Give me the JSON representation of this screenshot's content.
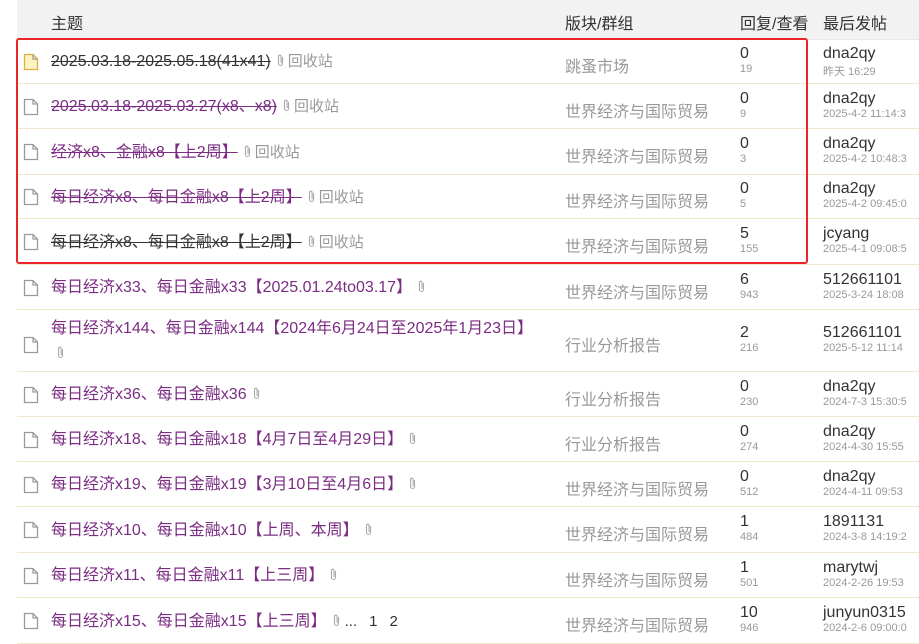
{
  "header": {
    "topic": "主题",
    "forum": "版块/群组",
    "stats": "回复/查看",
    "last_post": "最后发帖"
  },
  "colors": {
    "link_purple": "#7b2c83",
    "highlight_red": "#e8262a",
    "header_bg": "#f2f2f2",
    "row_divider": "#f0e6c8",
    "muted_gray": "#999999"
  },
  "threads": [
    {
      "title": "2025.03.18-2025.05.18(41x41)",
      "recycle": "回收站",
      "forum": "跳蚤市场",
      "replies": "0",
      "views": "19",
      "poster": "dna2qy",
      "time": "昨天 16:29"
    },
    {
      "title": "2025.03.18-2025.03.27(x8、x8)",
      "recycle": "回收站",
      "forum": "世界经济与国际贸易",
      "replies": "0",
      "views": "9",
      "poster": "dna2qy",
      "time": "2025-4-2 11:14:3"
    },
    {
      "title": "经济x8、金融x8【上2周】",
      "recycle": "回收站",
      "forum": "世界经济与国际贸易",
      "replies": "0",
      "views": "3",
      "poster": "dna2qy",
      "time": "2025-4-2 10:48:3"
    },
    {
      "title": "每日经济x8、每日金融x8【上2周】",
      "recycle": "回收站",
      "forum": "世界经济与国际贸易",
      "replies": "0",
      "views": "5",
      "poster": "dna2qy",
      "time": "2025-4-2 09:45:0"
    },
    {
      "title": "每日经济x8、每日金融x8【上2周】",
      "recycle": "回收站",
      "forum": "世界经济与国际贸易",
      "replies": "5",
      "views": "155",
      "poster": "jcyang",
      "time": "2025-4-1 09:08:5"
    },
    {
      "title": "每日经济x33、每日金融x33【2025.01.24to03.17】",
      "recycle": "",
      "forum": "世界经济与国际贸易",
      "replies": "6",
      "views": "943",
      "poster": "512661101",
      "time": "2025-3-24 18:08"
    },
    {
      "title": "每日经济x144、每日金融x144【2024年6月24日至2025年1月23日】",
      "recycle": "",
      "forum": "行业分析报告",
      "replies": "2",
      "views": "216",
      "poster": "512661101",
      "time": "2025-5-12 11:14"
    },
    {
      "title": "每日经济x36、每日金融x36",
      "recycle": "",
      "forum": "行业分析报告",
      "replies": "0",
      "views": "230",
      "poster": "dna2qy",
      "time": "2024-7-3 15:30:5"
    },
    {
      "title": "每日经济x18、每日金融x18【4月7日至4月29日】",
      "recycle": "",
      "forum": "行业分析报告",
      "replies": "0",
      "views": "274",
      "poster": "dna2qy",
      "time": "2024-4-30 15:55"
    },
    {
      "title": "每日经济x19、每日金融x19【3月10日至4月6日】",
      "recycle": "",
      "forum": "世界经济与国际贸易",
      "replies": "0",
      "views": "512",
      "poster": "dna2qy",
      "time": "2024-4-11 09:53"
    },
    {
      "title": "每日经济x10、每日金融x10【上周、本周】",
      "recycle": "",
      "forum": "世界经济与国际贸易",
      "replies": "1",
      "views": "484",
      "poster": "1891131",
      "time": "2024-3-8 14:19:2"
    },
    {
      "title": "每日经济x11、每日金融x11【上三周】",
      "recycle": "",
      "forum": "世界经济与国际贸易",
      "replies": "1",
      "views": "501",
      "poster": "marytwj",
      "time": "2024-2-26 19:53"
    },
    {
      "title": "每日经济x15、每日金融x15【上三周】",
      "recycle": "",
      "forum": "世界经济与国际贸易",
      "replies": "10",
      "views": "946",
      "poster": "junyun0315",
      "time": "2024-2-6 09:00:0",
      "pager": {
        "ellipsis": "...",
        "pages": [
          "1",
          "2"
        ]
      }
    }
  ]
}
